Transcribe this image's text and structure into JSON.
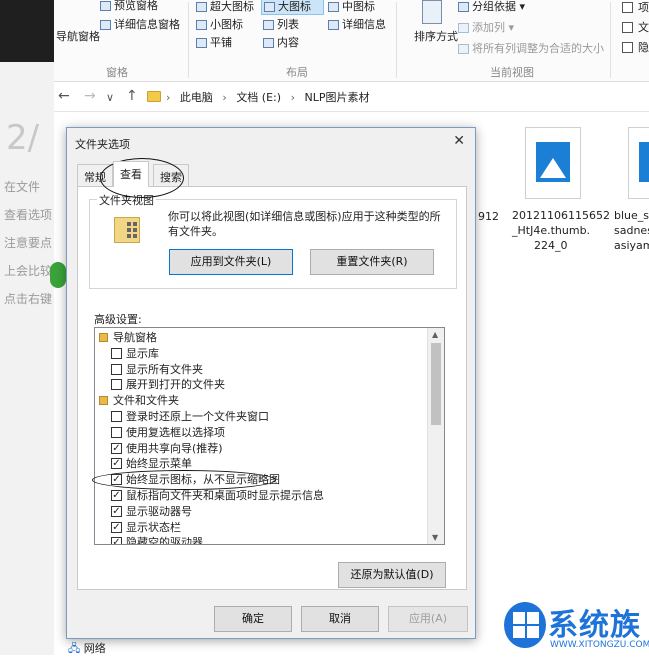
{
  "background_article": {
    "fragments": [
      "在文件",
      "查看选项",
      "注意要点",
      "上会比较",
      "点击右键"
    ],
    "big_number": "2/"
  },
  "ribbon": {
    "pane": {
      "nav_pane": "导航窗格",
      "preview_pane": "预览窗格",
      "details_pane": "详细信息窗格",
      "group_label": "窗格"
    },
    "layout": {
      "row1": [
        "超大图标",
        "大图标",
        "中图标"
      ],
      "row2": [
        "小图标",
        "列表",
        "详细信息"
      ],
      "row3": [
        "平铺",
        "内容"
      ],
      "selected": "大图标",
      "group_label": "布局"
    },
    "current_view": {
      "sort_by": "排序方式",
      "group_by": "分组依据",
      "add_column": "添加列",
      "fit_columns": "将所有列调整为合适的大小",
      "group_label": "当前视图"
    },
    "show_hide": [
      "项",
      "文",
      "隐"
    ]
  },
  "address_bar": {
    "breadcrumbs": [
      "此电脑",
      "文档 (E:)",
      "NLP图片素材"
    ]
  },
  "files": [
    {
      "name_lines": [
        "912"
      ]
    },
    {
      "name_lines": [
        "20121106115652",
        "_HtJ4e.thumb.",
        "224_0"
      ]
    },
    {
      "name_lines": [
        "blue_sc",
        "sadnes",
        "asiyam"
      ]
    }
  ],
  "nav_items": {
    "network": "网络"
  },
  "dialog": {
    "title": "文件夹选项",
    "tabs": [
      "常规",
      "查看",
      "搜索"
    ],
    "active_tab": "查看",
    "folder_view": {
      "group_title": "文件夹视图",
      "description": "你可以将此视图(如详细信息或图标)应用于这种类型的所有文件夹。",
      "apply_button": "应用到文件夹(L)",
      "reset_button": "重置文件夹(R)"
    },
    "advanced_label": "高级设置:",
    "advanced_items": [
      {
        "label": "导航窗格",
        "type": "header",
        "indent": 0
      },
      {
        "label": "显示库",
        "type": "checkbox",
        "checked": false,
        "indent": 1
      },
      {
        "label": "显示所有文件夹",
        "type": "checkbox",
        "checked": false,
        "indent": 1
      },
      {
        "label": "展开到打开的文件夹",
        "type": "checkbox",
        "checked": false,
        "indent": 1
      },
      {
        "label": "文件和文件夹",
        "type": "header",
        "indent": 0
      },
      {
        "label": "登录时还原上一个文件夹窗口",
        "type": "checkbox",
        "checked": false,
        "indent": 1
      },
      {
        "label": "使用复选框以选择项",
        "type": "checkbox",
        "checked": false,
        "indent": 1
      },
      {
        "label": "使用共享向导(推荐)",
        "type": "checkbox",
        "checked": true,
        "indent": 1
      },
      {
        "label": "始终显示菜单",
        "type": "checkbox",
        "checked": true,
        "indent": 1
      },
      {
        "label": "始终显示图标，从不显示缩略图",
        "type": "checkbox",
        "checked": true,
        "indent": 1
      },
      {
        "label": "鼠标指向文件夹和桌面项时显示提示信息",
        "type": "checkbox",
        "checked": true,
        "indent": 1
      },
      {
        "label": "显示驱动器号",
        "type": "checkbox",
        "checked": true,
        "indent": 1
      },
      {
        "label": "显示状态栏",
        "type": "checkbox",
        "checked": true,
        "indent": 1
      },
      {
        "label": "隐藏空的驱动器",
        "type": "checkbox",
        "checked": true,
        "indent": 1
      }
    ],
    "restore_defaults": "还原为默认值(D)",
    "ok": "确定",
    "cancel": "取消",
    "apply": "应用(A)"
  },
  "watermark": {
    "name": "系统族",
    "site": "WWW.XITONGZU.COM"
  }
}
